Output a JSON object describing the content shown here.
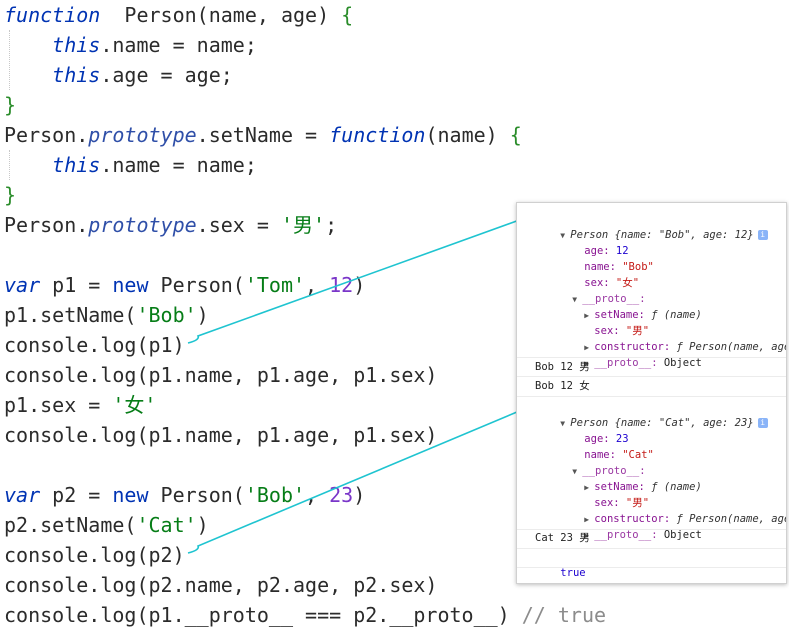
{
  "editor": {
    "lines": [
      [
        [
          "kw",
          "function"
        ],
        [
          "",
          "  Person(name, age) "
        ],
        [
          "br",
          "{"
        ]
      ],
      [
        [
          "",
          "    "
        ],
        [
          "kw",
          "this"
        ],
        [
          "",
          ".name = name;"
        ]
      ],
      [
        [
          "",
          "    "
        ],
        [
          "kw",
          "this"
        ],
        [
          "",
          ".age = age;"
        ]
      ],
      [
        [
          "br",
          "}"
        ]
      ],
      [
        [
          "",
          "Person."
        ],
        [
          "pr",
          "prototype"
        ],
        [
          "",
          ".setName = "
        ],
        [
          "kw",
          "function"
        ],
        [
          "",
          "(name) "
        ],
        [
          "br",
          "{"
        ]
      ],
      [
        [
          "",
          "    "
        ],
        [
          "kw",
          "this"
        ],
        [
          "",
          ".name = name;"
        ]
      ],
      [
        [
          "br",
          "}"
        ]
      ],
      [
        [
          "",
          "Person."
        ],
        [
          "pr",
          "prototype"
        ],
        [
          "",
          ".sex = "
        ],
        [
          "st",
          "'男'"
        ],
        [
          "",
          ";"
        ]
      ],
      [],
      [
        [
          "kw",
          "var"
        ],
        [
          "",
          " p1 = "
        ],
        [
          "kw2",
          "new"
        ],
        [
          "",
          " Person("
        ],
        [
          "st",
          "'Tom'"
        ],
        [
          "",
          ", "
        ],
        [
          "nm",
          "12"
        ],
        [
          "",
          ")"
        ]
      ],
      [
        [
          "",
          "p1.setName("
        ],
        [
          "st",
          "'Bob'"
        ],
        [
          "",
          ")"
        ]
      ],
      [
        [
          "",
          "console.log(p1)"
        ]
      ],
      [
        [
          "",
          "console.log(p1.name, p1.age, p1.sex)"
        ]
      ],
      [
        [
          "",
          "p1.sex = "
        ],
        [
          "st",
          "'女'"
        ]
      ],
      [
        [
          "",
          "console.log(p1.name, p1.age, p1.sex)"
        ]
      ],
      [],
      [
        [
          "kw",
          "var"
        ],
        [
          "",
          " p2 = "
        ],
        [
          "kw2",
          "new"
        ],
        [
          "",
          " Person("
        ],
        [
          "st",
          "'Bob'"
        ],
        [
          "",
          ", "
        ],
        [
          "nm",
          "23"
        ],
        [
          "",
          ")"
        ]
      ],
      [
        [
          "",
          "p2.setName("
        ],
        [
          "st",
          "'Cat'"
        ],
        [
          "",
          ")"
        ]
      ],
      [
        [
          "",
          "console.log(p2)"
        ]
      ],
      [
        [
          "",
          "console.log(p2.name, p2.age, p2.sex)"
        ]
      ],
      [
        [
          "",
          "console.log(p1.__proto__ === p2.__proto__) "
        ],
        [
          "cm",
          "// true"
        ]
      ]
    ]
  },
  "console": {
    "obj1": {
      "header_name": "Person",
      "header_preview": "{name: \"Bob\", age: 12}",
      "age_key": "age:",
      "age_val": "12",
      "name_key": "name:",
      "name_val": "\"Bob\"",
      "sex_key": "sex:",
      "sex_val": "\"女\"",
      "proto_key": "__proto__:",
      "setname_key": "setName:",
      "setname_val": "ƒ (name)",
      "psex_key": "sex:",
      "psex_val": "\"男\"",
      "ctor_key": "constructor:",
      "ctor_val": "ƒ Person(name, age)",
      "pproto_key": "__proto__:",
      "pproto_val": "Object"
    },
    "log1": "Bob 12 男",
    "log2": "Bob 12 女",
    "obj2": {
      "header_name": "Person",
      "header_preview": "{name: \"Cat\", age: 23}",
      "age_key": "age:",
      "age_val": "23",
      "name_key": "name:",
      "name_val": "\"Cat\"",
      "proto_key": "__proto__:",
      "setname_key": "setName:",
      "setname_val": "ƒ (name)",
      "psex_key": "sex:",
      "psex_val": "\"男\"",
      "ctor_key": "constructor:",
      "ctor_val": "ƒ Person(name, age)",
      "pproto_key": "__proto__:",
      "pproto_val": "Object"
    },
    "log3": "Cat 23 男",
    "log4": "true",
    "prompt": "›"
  },
  "icons": {
    "expanded": "▼",
    "collapsed": "▶",
    "info": "i"
  },
  "colors": {
    "keyword": "#0033b3",
    "string": "#067d17",
    "number": "#7a36c9",
    "arrow": "#1fc4d0"
  }
}
